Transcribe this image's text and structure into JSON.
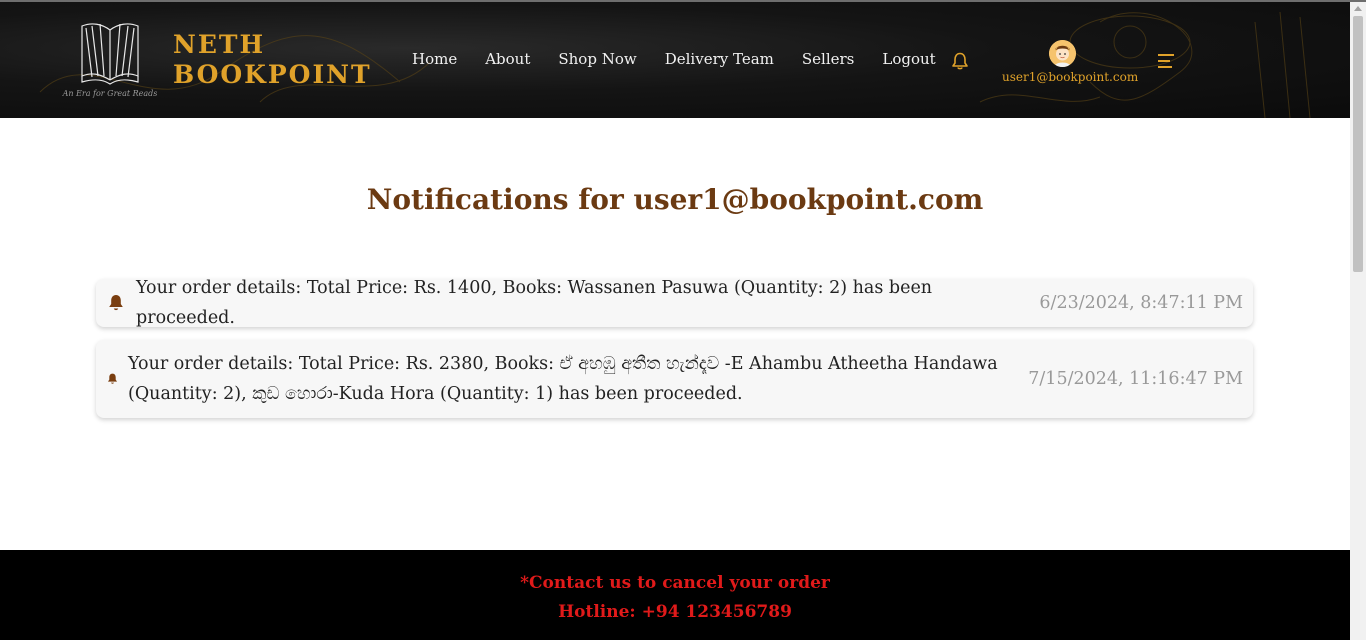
{
  "brand": {
    "line1": "NETH",
    "line2": "BOOKPOINT",
    "tagline": "An Era for Great Reads"
  },
  "nav": {
    "items": [
      {
        "label": "Home"
      },
      {
        "label": "About"
      },
      {
        "label": "Shop Now"
      },
      {
        "label": "Delivery Team"
      },
      {
        "label": "Sellers"
      },
      {
        "label": "Logout"
      }
    ]
  },
  "user": {
    "email": "user1@bookpoint.com"
  },
  "page": {
    "title": "Notifications for user1@bookpoint.com"
  },
  "notifications": [
    {
      "message": "Your order details: Total Price: Rs. 1400, Books: Wassanen Pasuwa (Quantity: 2) has been proceeded.",
      "timestamp": "6/23/2024, 8:47:11 PM"
    },
    {
      "message": "Your order details: Total Price: Rs. 2380, Books: ඒ අහඹු අතීත හැන්දෑව -E Ahambu Atheetha Handawa (Quantity: 2), කුඩ හොරා-Kuda Hora (Quantity: 1) has been proceeded.",
      "timestamp": "7/15/2024, 11:16:47 PM"
    }
  ],
  "footer": {
    "line1": "*Contact us to cancel your order",
    "line2": "Hotline: +94 123456789"
  },
  "colors": {
    "brand_gold": "#e0a22a",
    "title_brown": "#6b3a12",
    "bell_brown": "#7a3e10",
    "footer_red": "#e01a1a",
    "header_bg": "#111111"
  },
  "icons": {
    "logo": "open-book-icon",
    "notifications": "bell-icon",
    "menu": "hamburger-menu-icon",
    "avatar": "user-avatar"
  }
}
